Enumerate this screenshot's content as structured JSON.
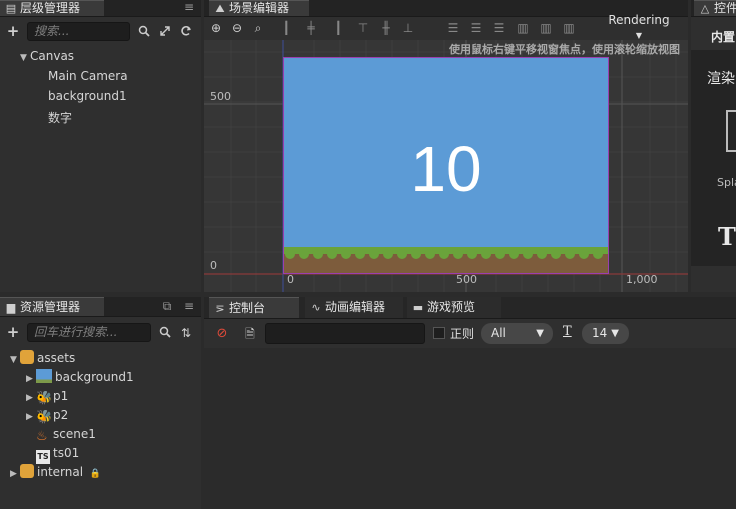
{
  "hierarchy": {
    "title": "层级管理器",
    "search_placeholder": "搜索...",
    "items": [
      {
        "label": "Canvas"
      },
      {
        "label": "Main Camera"
      },
      {
        "label": "background1"
      },
      {
        "label": "数字"
      }
    ]
  },
  "scene": {
    "title": "场景编辑器",
    "rendering_label": "Rendering",
    "hint": "使用鼠标右键平移视窗焦点，使用滚轮缩放视图",
    "axis": {
      "y_500": "500",
      "y_0": "0",
      "x_0": "0",
      "x_500": "500",
      "x_1000": "1,000"
    },
    "canvas_text": "10",
    "canvas_color": "#5c9bd6",
    "grass_color": "#6aa33b",
    "dirt_color": "#7d5c3c"
  },
  "inspector": {
    "title": "控件",
    "builtin_label": "内置",
    "render_label": "渲染",
    "splash_label": "Spla",
    "t_icon": "T"
  },
  "assets": {
    "title": "资源管理器",
    "search_placeholder": "回车进行搜索...",
    "items": [
      {
        "label": "assets",
        "icon": "folder-icon"
      },
      {
        "label": "background1",
        "icon": "image-icon"
      },
      {
        "label": "p1",
        "icon": "sprite-icon"
      },
      {
        "label": "p2",
        "icon": "sprite-icon"
      },
      {
        "label": "scene1",
        "icon": "scene-flame-icon"
      },
      {
        "label": "ts01",
        "icon": "typescript-icon"
      },
      {
        "label": "internal",
        "icon": "folder-icon"
      }
    ]
  },
  "console": {
    "tabs": [
      {
        "label": "控制台",
        "icon": "console-icon"
      },
      {
        "label": "动画编辑器",
        "icon": "animation-icon"
      },
      {
        "label": "游戏预览",
        "icon": "game-preview-icon"
      }
    ],
    "regex_label": "正则",
    "filter_value": "All",
    "font_size_value": "14"
  }
}
